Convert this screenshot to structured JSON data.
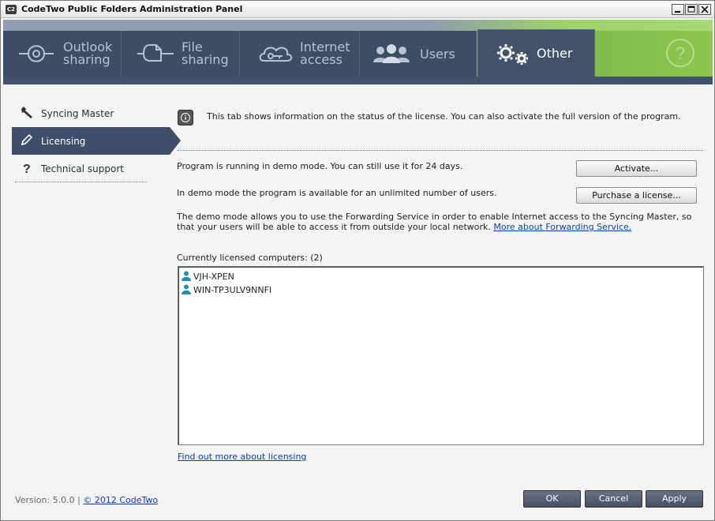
{
  "window": {
    "title": "CodeTwo Public Folders Administration Panel",
    "app_icon_text": "C2"
  },
  "tabs": [
    {
      "label": "Outlook\nsharing",
      "icon": "outlook-sharing-icon"
    },
    {
      "label": "File\nsharing",
      "icon": "file-sharing-icon"
    },
    {
      "label": "Internet\naccess",
      "icon": "cloud-key-icon"
    },
    {
      "label": "Users",
      "icon": "users-icon"
    },
    {
      "label": "Other",
      "icon": "gears-icon",
      "selected": true
    }
  ],
  "help_icon": "question-circle-icon",
  "sidebar": {
    "items": [
      {
        "label": "Syncing Master",
        "icon": "wrench-icon"
      },
      {
        "label": "Licensing",
        "icon": "pencil-icon",
        "selected": true
      },
      {
        "label": "Technical support",
        "icon": "question-icon"
      }
    ]
  },
  "main": {
    "info_text": "This tab shows information on the status of the license. You can also activate the full version of the program.",
    "demo_status": "Program is running in demo mode. You can still use it for 24 days.",
    "demo_users": "In demo mode the program is available for an unlimited number of users.",
    "forwarding_text": "The demo mode allows you to use the Forwarding Service in order to enable Internet access to the Syncing Master, so that your users will be able to access it from outside your local network.",
    "forwarding_link": "More about Forwarding Service.",
    "activate_button": "Activate...",
    "purchase_button": "Purchase a license...",
    "licensed_label": "Currently licensed computers:",
    "licensed_count": "(2)",
    "computers": [
      "VJH-XPEN",
      "WIN-TP3ULV9NNFI"
    ],
    "find_out_link": "Find out more about licensing"
  },
  "footer": {
    "version": "Version: 5.0.0 |",
    "copyright_link": "© 2012 CodeTwo",
    "ok": "OK",
    "cancel": "Cancel",
    "apply": "Apply"
  },
  "colors": {
    "tab_bg": "#3d4d66",
    "accent_green": "#8ec74f",
    "active_item": "#3f4f6a",
    "link": "#0b3fa8"
  }
}
